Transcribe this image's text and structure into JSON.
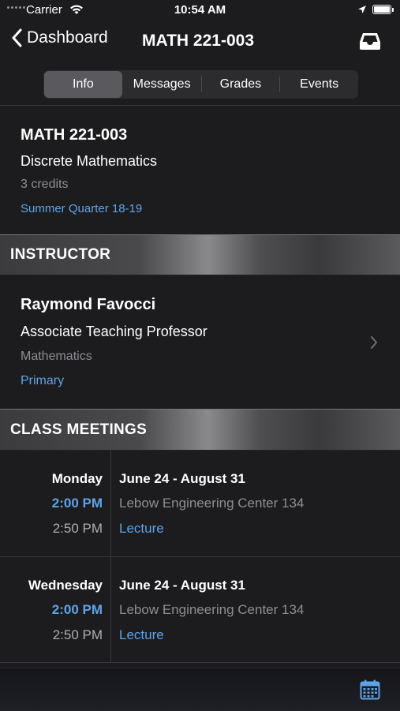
{
  "status": {
    "carrier": "Carrier",
    "time": "10:54 AM"
  },
  "nav": {
    "back_label": "Dashboard",
    "title": "MATH 221-003"
  },
  "tabs": [
    {
      "label": "Info",
      "active": true
    },
    {
      "label": "Messages",
      "active": false
    },
    {
      "label": "Grades",
      "active": false
    },
    {
      "label": "Events",
      "active": false
    }
  ],
  "course": {
    "code": "MATH 221-003",
    "name": "Discrete Mathematics",
    "credits": "3 credits",
    "term": "Summer Quarter 18-19"
  },
  "instructor_section": {
    "header": "INSTRUCTOR"
  },
  "instructor": {
    "name": "Raymond Favocci",
    "title": "Associate Teaching Professor",
    "department": "Mathematics",
    "role": "Primary"
  },
  "meetings_section": {
    "header": "CLASS MEETINGS"
  },
  "meetings": [
    {
      "day": "Monday",
      "start": "2:00 PM",
      "end": "2:50 PM",
      "dates": "June 24 - August 31",
      "location": "Lebow Engineering Center 134",
      "type": "Lecture"
    },
    {
      "day": "Wednesday",
      "start": "2:00 PM",
      "end": "2:50 PM",
      "dates": "June 24 - August 31",
      "location": "Lebow Engineering Center 134",
      "type": "Lecture"
    }
  ],
  "colors": {
    "accent": "#5ea4e8",
    "background": "#1c1c1e",
    "secondary_text": "#8e8e93"
  },
  "icons": {
    "back": "chevron-left-icon",
    "inbox": "inbox-tray-icon",
    "disclosure": "chevron-right-icon",
    "calendar": "calendar-icon"
  }
}
